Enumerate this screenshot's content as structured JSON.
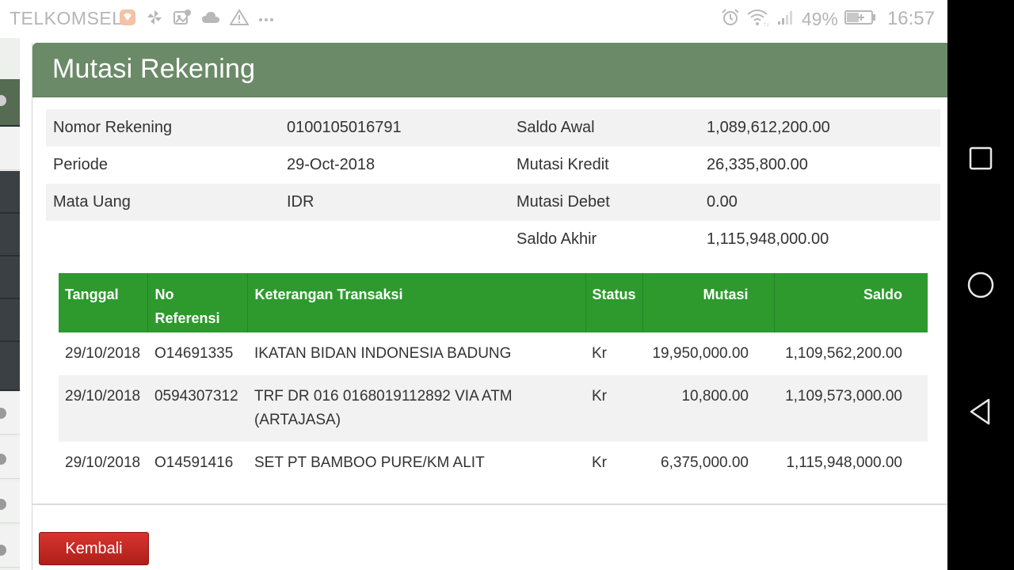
{
  "statusbar": {
    "carrier": "TELKOMSEL",
    "battery_percent": "49%",
    "time": "16:57",
    "icons": [
      "notification-app-icon",
      "pinwheel-icon",
      "photo-sync-icon",
      "cloud-icon",
      "warning-icon",
      "more-dots-icon",
      "alarm-icon",
      "wifi-icon",
      "signal-icon",
      "battery-icon"
    ]
  },
  "panel": {
    "title": "Mutasi Rekening",
    "summary": [
      {
        "label1": "Nomor Rekening",
        "value1": "0100105016791",
        "label2": "Saldo Awal",
        "value2": "1,089,612,200.00"
      },
      {
        "label1": "Periode",
        "value1": "29-Oct-2018",
        "label2": "Mutasi Kredit",
        "value2": "26,335,800.00"
      },
      {
        "label1": "Mata Uang",
        "value1": "IDR",
        "label2": "Mutasi Debet",
        "value2": "0.00"
      },
      {
        "label1": "",
        "value1": "",
        "label2": "Saldo Akhir",
        "value2": "1,115,948,000.00"
      }
    ],
    "table": {
      "headers": {
        "tanggal": "Tanggal",
        "no_ref_line1": "No",
        "no_ref_line2": "Referensi",
        "keterangan": "Keterangan Transaksi",
        "status": "Status",
        "mutasi": "Mutasi",
        "saldo": "Saldo"
      },
      "rows": [
        {
          "tanggal": "29/10/2018",
          "no_ref": "O14691335",
          "keterangan_line1": "IKATAN BIDAN INDONESIA BADUNG",
          "keterangan_line2": "",
          "status": "Kr",
          "mutasi": "19,950,000.00",
          "saldo": "1,109,562,200.00"
        },
        {
          "tanggal": "29/10/2018",
          "no_ref": "0594307312",
          "keterangan_line1": "TRF DR 016 0168019112892 VIA ATM",
          "keterangan_line2": "(ARTAJASA)",
          "status": "Kr",
          "mutasi": "10,800.00",
          "saldo": "1,109,573,000.00"
        },
        {
          "tanggal": "29/10/2018",
          "no_ref": "O14591416",
          "keterangan_line1": "SET PT BAMBOO PURE/KM ALIT",
          "keterangan_line2": "",
          "status": "Kr",
          "mutasi": "6,375,000.00",
          "saldo": "1,115,948,000.00"
        }
      ]
    },
    "back_button_label": "Kembali"
  },
  "navbar": {
    "buttons": [
      "recent-apps-icon",
      "home-icon",
      "back-icon"
    ]
  },
  "colors": {
    "header_bg": "#6b8a67",
    "table_header_bg": "#2e9a2e",
    "back_button_bg": "#c42a24",
    "row_shade": "#f2f2f2"
  }
}
